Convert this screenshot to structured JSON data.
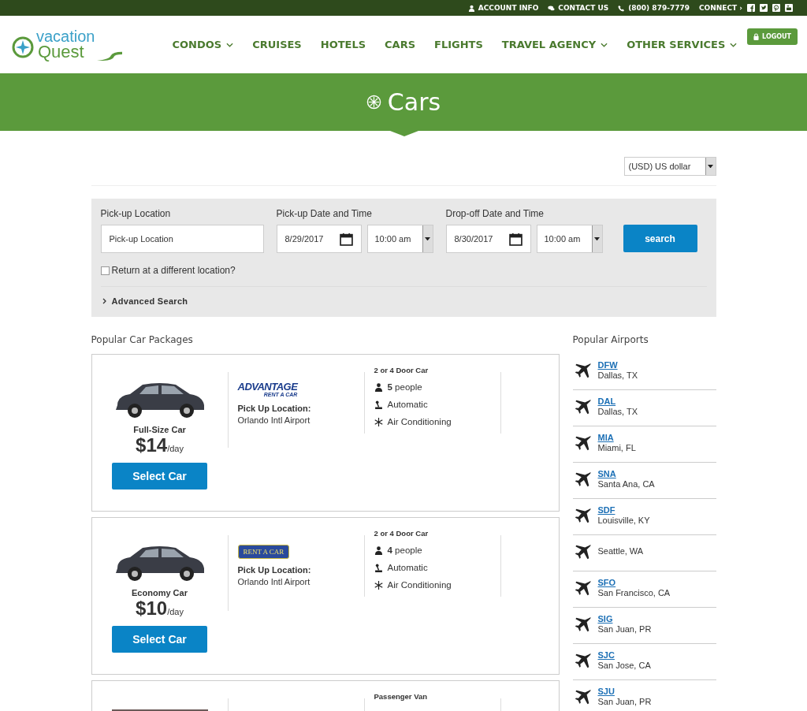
{
  "top_bar": {
    "items": [
      {
        "kind": "account",
        "label": "ACCOUNT INFO"
      },
      {
        "kind": "contact",
        "label": "CONTACT US"
      },
      {
        "kind": "phone",
        "label": "(800) 879-7779"
      },
      {
        "kind": "connect",
        "label": "CONNECT ›"
      }
    ]
  },
  "logo": {
    "line1": "vacation",
    "line2": "Quest"
  },
  "nav": [
    {
      "label": "CONDOS",
      "dropdown": true
    },
    {
      "label": "CRUISES",
      "dropdown": false
    },
    {
      "label": "HOTELS",
      "dropdown": false
    },
    {
      "label": "CARS",
      "dropdown": false
    },
    {
      "label": "FLIGHTS",
      "dropdown": false
    },
    {
      "label": "TRAVEL AGENCY",
      "dropdown": true
    },
    {
      "label": "OTHER SERVICES",
      "dropdown": true
    }
  ],
  "logout": "LOGOUT",
  "banner": {
    "title": "Cars"
  },
  "currency": "(USD) US dollar",
  "search": {
    "pickup_location": {
      "label": "Pick-up Location",
      "placeholder": "Pick-up Location"
    },
    "pickup": {
      "label": "Pick-up Date and Time",
      "date": "8/29/2017",
      "time": "10:00 am"
    },
    "dropoff": {
      "label": "Drop-off Date and Time",
      "date": "8/30/2017",
      "time": "10:00 am"
    },
    "button": "search",
    "return_different": {
      "label": "Return at a different location?",
      "checked": false
    },
    "advanced": "Advanced Search"
  },
  "packages": {
    "heading": "Popular Car Packages",
    "cars": [
      {
        "kind": "full",
        "name": "Full-Size Car",
        "price": "$14",
        "unit": "/day",
        "vendor": {
          "name": "ADVANTAGE",
          "tagline": "RENT A CAR"
        },
        "pickup_label": "Pick Up Location:",
        "pickup_location": "Orlando Intl Airport",
        "car_type": "2 or 4 Door Car",
        "people": "**5** people",
        "transmission": "Automatic",
        "feature": "Air Conditioning",
        "button": "Select Car"
      },
      {
        "kind": "full",
        "name": "Economy Car",
        "price": "$10",
        "unit": "/day",
        "vendor": {
          "tagline": "RENT A CAR"
        },
        "pickup_label": "Pick Up Location:",
        "pickup_location": "Orlando Intl Airport",
        "car_type": "2 or 4 Door Car",
        "people": "**4** people",
        "transmission": "Automatic",
        "feature": "Air Conditioning",
        "button": "Select Car"
      },
      {
        "kind": "partial",
        "car_type": "Passenger Van"
      }
    ]
  },
  "airports": {
    "heading": "Popular Airports",
    "items": [
      {
        "code": "DFW",
        "city": "Dallas, TX"
      },
      {
        "code": "DAL",
        "city": "Dallas, TX"
      },
      {
        "code": "MIA",
        "city": "Miami, FL"
      },
      {
        "code": "SNA",
        "city": "Santa Ana, CA"
      },
      {
        "code": "SDF",
        "city": "Louisville, KY"
      },
      {
        "city": "Seattle, WA"
      },
      {
        "code": "SFO",
        "city": "San Francisco, CA"
      },
      {
        "code": "SIG",
        "city": "San Juan, PR"
      },
      {
        "code": "SJC",
        "city": "San Jose, CA"
      },
      {
        "code": "SJU",
        "city": "San Juan, PR"
      }
    ]
  }
}
